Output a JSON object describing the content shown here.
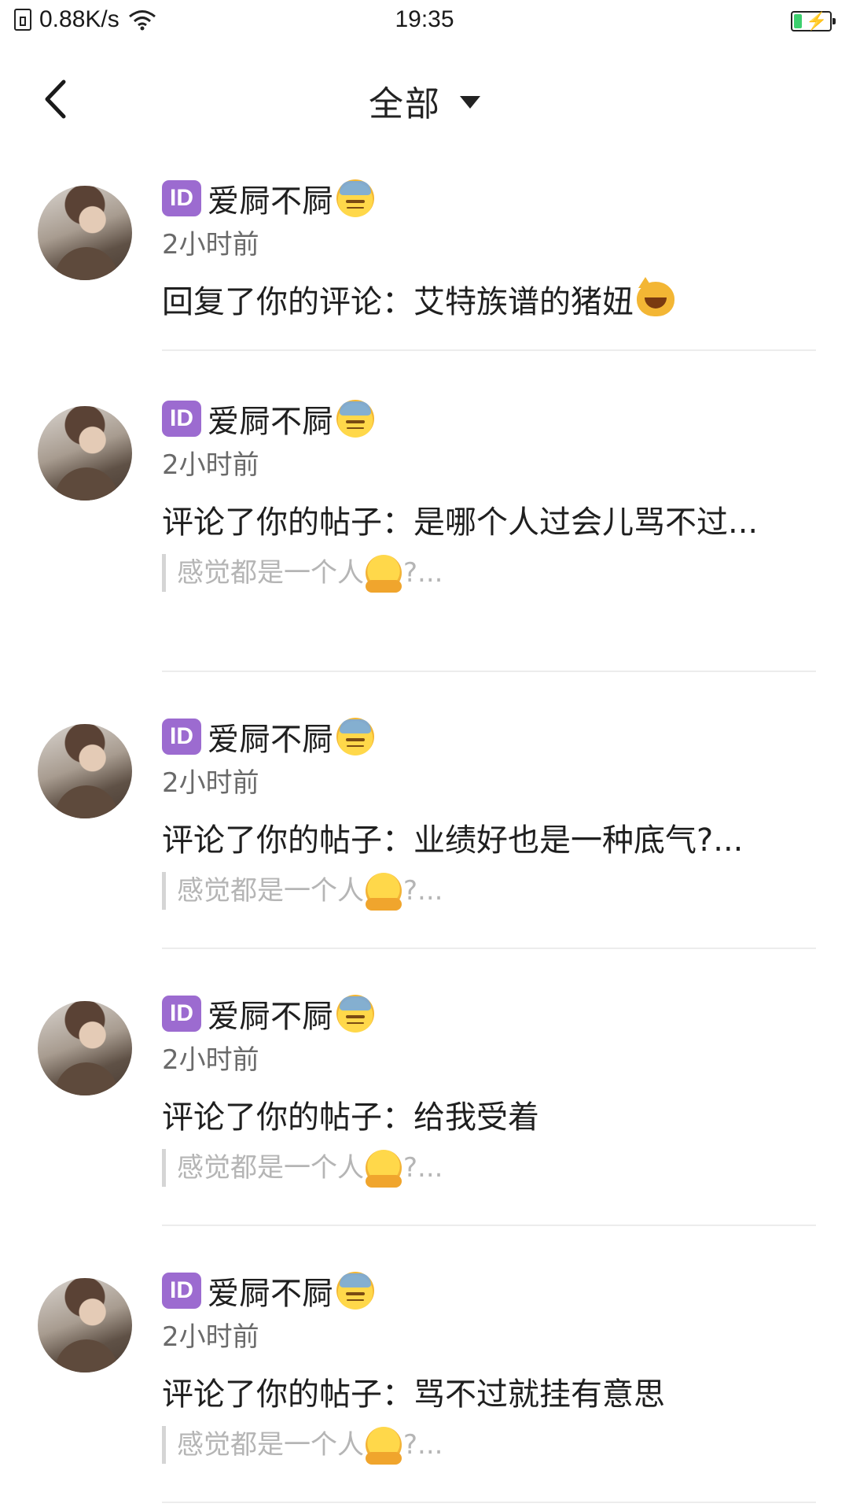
{
  "status_bar": {
    "net_speed": "0.88K/s",
    "time": "19:35",
    "battery_color": "#3ccf6e"
  },
  "header": {
    "title": "全部",
    "back_icon": "chevron-left-icon",
    "dropdown_icon": "caret-down-icon"
  },
  "notifications": [
    {
      "username": "爱屙不屙",
      "time": "2小时前",
      "action_prefix": "回复了你的评论：",
      "action_text": "艾特族谱的猪妞",
      "quote_text": "",
      "quote_suffix": ""
    },
    {
      "username": "爱屙不屙",
      "time": "2小时前",
      "action_prefix": "评论了你的帖子：",
      "action_text": "是哪个人过会儿骂不过...",
      "quote_text": "感觉都是一个人",
      "quote_suffix": "?..."
    },
    {
      "username": "爱屙不屙",
      "time": "2小时前",
      "action_prefix": "评论了你的帖子：",
      "action_text": "业绩好也是一种底气?...",
      "quote_text": "感觉都是一个人",
      "quote_suffix": "?..."
    },
    {
      "username": "爱屙不屙",
      "time": "2小时前",
      "action_prefix": "评论了你的帖子：",
      "action_text": "给我受着",
      "quote_text": "感觉都是一个人",
      "quote_suffix": "?..."
    },
    {
      "username": "爱屙不屙",
      "time": "2小时前",
      "action_prefix": "评论了你的帖子：",
      "action_text": "骂不过就挂有意思",
      "quote_text": "感觉都是一个人",
      "quote_suffix": "?..."
    }
  ],
  "badge": {
    "label": "ID",
    "color": "#9c6bd0"
  }
}
